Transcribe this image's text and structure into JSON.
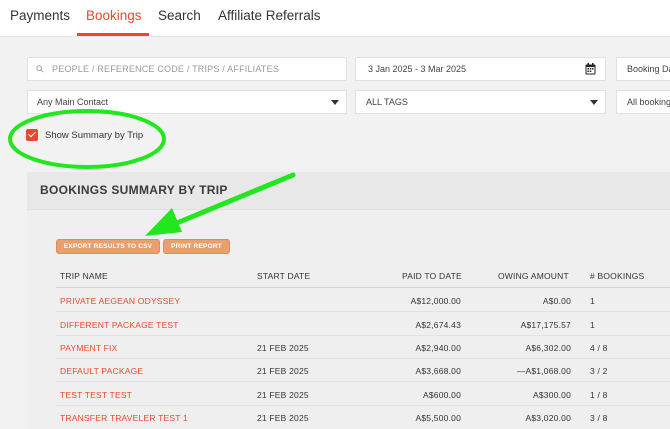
{
  "nav": {
    "tabs": [
      {
        "label": "Payments"
      },
      {
        "label": "Bookings"
      },
      {
        "label": "Search"
      },
      {
        "label": "Affiliate Referrals"
      }
    ]
  },
  "filters": {
    "search_placeholder": "PEOPLE / REFERENCE CODE / TRIPS / AFFILIATES",
    "date_range": "3 Jan 2025 - 3 Mar 2025",
    "date_type": "Booking Da",
    "main_contact": "Any Main Contact",
    "tags": "ALL TAGS",
    "bookings": "All booking"
  },
  "summary_toggle": {
    "label": "Show Summary by Trip",
    "checked": true
  },
  "summary": {
    "title": "BOOKINGS SUMMARY BY TRIP",
    "export_label": "EXPORT RESULTS TO CSV",
    "print_label": "PRINT REPORT",
    "columns": [
      "TRIP NAME",
      "START DATE",
      "PAID TO DATE",
      "OWING AMOUNT",
      "# BOOKINGS"
    ],
    "rows": [
      {
        "name": "PRIVATE AEGEAN ODYSSEY",
        "start": "",
        "paid": "A$12,000.00",
        "owing": "A$0.00",
        "bookings": "1"
      },
      {
        "name": "DIFFERENT PACKAGE TEST",
        "start": "",
        "paid": "A$2,674.43",
        "owing": "A$17,175.57",
        "bookings": "1"
      },
      {
        "name": "PAYMENT FIX",
        "start": "21 FEB 2025",
        "paid": "A$2,940.00",
        "owing": "A$6,302.00",
        "bookings": "4 / 8"
      },
      {
        "name": "DEFAULT PACKAGE",
        "start": "21 FEB 2025",
        "paid": "A$3,668.00",
        "owing": "—A$1,068.00",
        "bookings": "3 / 2"
      },
      {
        "name": "TEST TEST TEST",
        "start": "21 FEB 2025",
        "paid": "A$600.00",
        "owing": "A$300.00",
        "bookings": "1 / 8"
      },
      {
        "name": "TRANSFER TRAVELER TEST 1",
        "start": "21 FEB 2025",
        "paid": "A$5,500.00",
        "owing": "A$3,020.00",
        "bookings": "3 / 8"
      }
    ]
  },
  "colors": {
    "accent": "#e8482f",
    "button": "#e9a06e",
    "annotation": "#22e61e"
  },
  "icons": [
    "search-icon",
    "calendar-icon",
    "chevron-down-icon",
    "check-icon"
  ]
}
